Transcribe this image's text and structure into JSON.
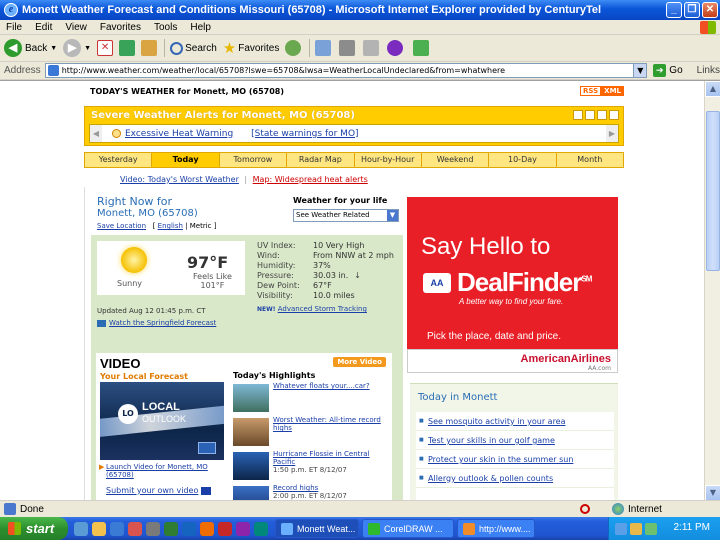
{
  "window": {
    "title": "Monett Weather Forecast and Conditions Missouri (65708) - Microsoft Internet Explorer provided by CenturyTel"
  },
  "menu": [
    "File",
    "Edit",
    "View",
    "Favorites",
    "Tools",
    "Help"
  ],
  "toolbar": {
    "back": "Back",
    "search": "Search",
    "favorites": "Favorites"
  },
  "address": {
    "label": "Address",
    "url": "http://www.weather.com/weather/local/65708?lswe=65708&lwsa=WeatherLocalUndeclared&from=whatwhere",
    "go": "Go",
    "links": "Links"
  },
  "page": {
    "header": "TODAY'S WEATHER for Monett, MO (65708)",
    "rss": [
      "RSS",
      "XML"
    ],
    "alerts": {
      "title": "Severe Weather Alerts for Monett, MO (65708)",
      "warning": "Excessive Heat Warning",
      "state_link": "[State warnings for MO]"
    },
    "tabs": [
      "Yesterday",
      "Today",
      "Tomorrow",
      "Radar Map",
      "Hour-by-Hour",
      "Weekend",
      "10-Day",
      "Month"
    ],
    "video_links": {
      "video": "Video: Today's Worst Weather",
      "sep": "|",
      "map": "Map: Widespread heat alerts"
    },
    "right_now": {
      "title": "Right Now for",
      "location": "Monett, MO (65708)",
      "save": "Save Location",
      "english": "English",
      "metric": "Metric"
    },
    "wfl": {
      "title": "Weather for your life",
      "select": "See Weather Related"
    },
    "conditions": {
      "sky": "Sunny",
      "temp": "97°F",
      "feels_label": "Feels Like",
      "feels": "101°F",
      "updated": "Updated Aug 12 01:45 p.m. CT",
      "watch": "Watch the Springfield Forecast",
      "obs": [
        {
          "k": "UV Index:",
          "v": "10 Very High"
        },
        {
          "k": "Wind:",
          "v": "From NNW at 2 mph"
        },
        {
          "k": "Humidity:",
          "v": "37%"
        },
        {
          "k": "Pressure:",
          "v": "30.03 in."
        },
        {
          "k": "Dew Point:",
          "v": "67°F"
        },
        {
          "k": "Visibility:",
          "v": "10.0 miles"
        }
      ],
      "pressure_trend": "↓",
      "new": "NEW!",
      "advanced": "Advanced Storm Tracking"
    },
    "video": {
      "title": "VIDEO",
      "more": "More Video",
      "local_forecast": "Your Local Forecast",
      "thumb_lo": "LO",
      "thumb_local": "LOCAL",
      "thumb_outlook": "OUTLOOK",
      "launch": "Launch Video for Monett, MO (65708)",
      "submit": "Submit your own video",
      "highlights_title": "Today's Highlights",
      "highlights": [
        {
          "title": "Whatever floats your....car?",
          "time": ""
        },
        {
          "title": "Worst Weather: All-time record highs",
          "time": ""
        },
        {
          "title": "Hurricane Flossie in Central Pacific",
          "time": "1:50 p.m. ET 8/12/07"
        },
        {
          "title": "Record highs",
          "time": "2:00 p.m. ET 8/12/07"
        }
      ]
    },
    "ad": {
      "line1": "Say Hello to",
      "logo": "AA",
      "brand": "DealFinder",
      "sm": "SM",
      "tagline": "A better way to find your fare.",
      "line3": "Pick the place, date and price.",
      "airline": "AmericanAirlines",
      "domain": "AA.com"
    },
    "today": {
      "title": "Today in Monett",
      "items": [
        "See mosquito activity in your area",
        "Test your skills in our golf game",
        "Protect your skin in the summer sun",
        "Allergy outlook & pollen counts"
      ]
    }
  },
  "status": {
    "text": "Done",
    "zone": "Internet"
  },
  "taskbar": {
    "start": "start",
    "tasks": [
      "Monett Weat...",
      "CorelDRAW ...",
      "http://www...."
    ],
    "clock": "2:11 PM"
  },
  "colors": {
    "accent": "#ffcc00",
    "link": "#1a3fa8",
    "ad_red": "#e81f27"
  }
}
